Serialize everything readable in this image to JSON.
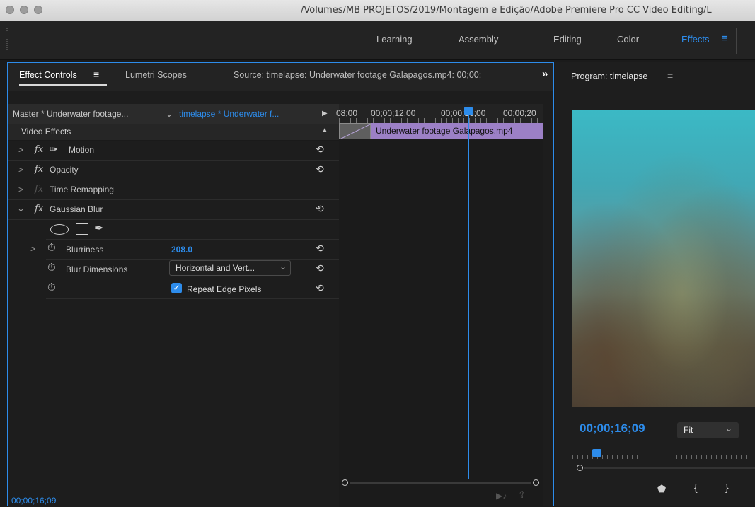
{
  "titlebar": {
    "path": "/Volumes/MB PROJETOS/2019/Montagem e Edição/Adobe Premiere Pro CC Video Editing/L"
  },
  "workspaces": {
    "items": [
      "Learning",
      "Assembly",
      "Editing",
      "Color",
      "Effects"
    ],
    "active": "Effects",
    "menu_icon": "≡"
  },
  "effect_controls": {
    "tabs": [
      "Effect Controls",
      "Lumetri Scopes"
    ],
    "tab_menu_icon": "≡",
    "source_label": "Source: timelapse: Underwater footage Galapagos.mp4: 00;00;",
    "overflow_icon": "»",
    "master_label": "Master * Underwater footage...",
    "sequence_label": "timelapse * Underwater f...",
    "video_effects_label": "Video Effects",
    "effects": [
      {
        "name": "Motion",
        "fx": "fx"
      },
      {
        "name": "Opacity",
        "fx": "fx"
      },
      {
        "name": "Time Remapping",
        "fx": "fx"
      },
      {
        "name": "Gaussian Blur",
        "fx": "fx"
      }
    ],
    "blurriness_label": "Blurriness",
    "blurriness_value": "208.0",
    "blur_dimensions_label": "Blur Dimensions",
    "blur_dimensions_value": "Horizontal and Vert...",
    "repeat_edge_label": "Repeat Edge Pixels",
    "repeat_edge_checked": true,
    "timecode": "00;00;16;09"
  },
  "timeline": {
    "ruler": [
      "08;00",
      "00;00;12;00",
      "00;00;16;00",
      "00;00;20"
    ],
    "clip_label": "Underwater footage Galapagos.mp4"
  },
  "program": {
    "title": "Program: timelapse",
    "menu_icon": "≡",
    "timecode": "00;00;16;09",
    "fit_label": "Fit"
  },
  "colors": {
    "accent": "#2d8ceb",
    "clip": "#9c80c6"
  }
}
